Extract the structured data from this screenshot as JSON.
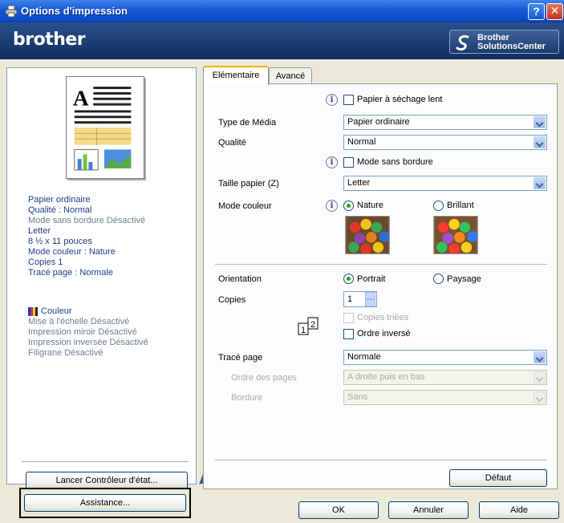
{
  "window": {
    "title": "Options d'impression",
    "help_label": "?",
    "close_label": "✕"
  },
  "brand": {
    "logo": "brother",
    "solutions_line1": "Brother",
    "solutions_line2": "SolutionsCenter"
  },
  "summary": {
    "lines": [
      "Papier ordinaire",
      "Qualité : Normal",
      "Mode sans bordure Désactivé",
      "Letter",
      "8 ½ x 11 pouces",
      "Mode couleur : Nature",
      "Copies 1",
      "Tracé page : Normale"
    ],
    "color_label": "Couleur",
    "extra_lines": [
      "Mise à l'échelle Désactivé",
      "Impression miroir Désactivé",
      "Impression inversée Désactivé",
      "Filigrane Désactivé"
    ]
  },
  "left_buttons": {
    "status_monitor": "Lancer Contrôleur d'état...",
    "assistance": "Assistance..."
  },
  "tabs": [
    "Elémentaire",
    "Avancé"
  ],
  "form": {
    "slow_dry_label": "Papier à séchage lent",
    "media_type_label": "Type de Média",
    "media_type_value": "Papier ordinaire",
    "quality_label": "Qualité",
    "quality_value": "Normal",
    "borderless_label": "Mode sans bordure",
    "paper_size_label": "Taille papier (Z)",
    "paper_size_value": "Letter",
    "color_mode_label": "Mode couleur",
    "color_nature": "Nature",
    "color_brillant": "Brillant",
    "orientation_label": "Orientation",
    "portrait": "Portrait",
    "landscape": "Paysage",
    "copies_label": "Copies",
    "copies_value": "1",
    "collate_label": "Copies triées",
    "reverse_label": "Ordre inversé",
    "layout_label": "Tracé page",
    "layout_value": "Normale",
    "page_order_label": "Ordre des pages",
    "page_order_value": "A droite puis en bas",
    "border_label": "Bordure",
    "border_value": "Sans",
    "default_button": "Défaut"
  },
  "dialog_buttons": {
    "ok": "OK",
    "cancel": "Annuler",
    "help": "Aide"
  },
  "colors": {
    "titlebar": "#0b4bc8",
    "brandbar": "#1b3a6b",
    "dialog_bg": "#ece9d8",
    "tab_accent": "#f2b41c"
  }
}
